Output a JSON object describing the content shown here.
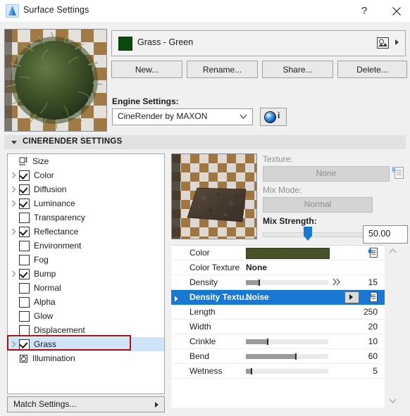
{
  "window": {
    "title": "Surface Settings",
    "icon": "archicad-triangle-icon",
    "help_label": "?",
    "close_label": "close-icon"
  },
  "material": {
    "name": "Grass - Green",
    "swatch_color": "#0a4a0a",
    "picker_icon": "image-picker-icon",
    "expand_icon": "triangle-right-icon"
  },
  "actions": [
    {
      "label": "New...",
      "name": "new-button"
    },
    {
      "label": "Rename...",
      "name": "rename-button"
    },
    {
      "label": "Share...",
      "name": "share-button"
    },
    {
      "label": "Delete...",
      "name": "delete-button"
    }
  ],
  "engine": {
    "label": "Engine Settings:",
    "selected": "CineRender by MAXON",
    "info_label": "i"
  },
  "section": {
    "title": "CINERENDER SETTINGS",
    "expanded": true
  },
  "channels": [
    {
      "label": "Size",
      "checkbox": false,
      "icon": "size-icon",
      "expandable": false,
      "selected": false
    },
    {
      "label": "Color",
      "checkbox": true,
      "icon": null,
      "expandable": true,
      "selected": false
    },
    {
      "label": "Diffusion",
      "checkbox": true,
      "icon": null,
      "expandable": true,
      "selected": false
    },
    {
      "label": "Luminance",
      "checkbox": true,
      "icon": null,
      "expandable": true,
      "selected": false
    },
    {
      "label": "Transparency",
      "checkbox": false,
      "icon": null,
      "expandable": false,
      "selected": false
    },
    {
      "label": "Reflectance",
      "checkbox": true,
      "icon": null,
      "expandable": true,
      "selected": false
    },
    {
      "label": "Environment",
      "checkbox": false,
      "icon": null,
      "expandable": false,
      "selected": false
    },
    {
      "label": "Fog",
      "checkbox": false,
      "icon": null,
      "expandable": false,
      "selected": false
    },
    {
      "label": "Bump",
      "checkbox": true,
      "icon": null,
      "expandable": true,
      "selected": false
    },
    {
      "label": "Normal",
      "checkbox": false,
      "icon": null,
      "expandable": false,
      "selected": false
    },
    {
      "label": "Alpha",
      "checkbox": false,
      "icon": null,
      "expandable": false,
      "selected": false
    },
    {
      "label": "Glow",
      "checkbox": false,
      "icon": null,
      "expandable": false,
      "selected": false
    },
    {
      "label": "Displacement",
      "checkbox": false,
      "icon": null,
      "expandable": false,
      "selected": false
    },
    {
      "label": "Grass",
      "checkbox": true,
      "icon": null,
      "expandable": true,
      "selected": true
    },
    {
      "label": "Illumination",
      "checkbox": false,
      "icon": "illumination-icon",
      "expandable": false,
      "selected": false
    }
  ],
  "match_settings": {
    "label": "Match Settings...",
    "arrow_icon": "triangle-right-icon"
  },
  "texture_panel": {
    "texture_label": "Texture:",
    "texture_value": "None",
    "texture_browse_icon": "load-texture-icon",
    "mix_mode_label": "Mix Mode:",
    "mix_mode_value": "Normal",
    "mix_strength_label": "Mix Strength:",
    "mix_strength_value": "50.00",
    "mix_strength_percent": 43
  },
  "properties": [
    {
      "name": "Color",
      "type": "color",
      "value": "",
      "swatch": "#4a5429",
      "selected": false,
      "expandable": false,
      "has_load_icon": true
    },
    {
      "name": "Color Texture",
      "type": "text",
      "value": "None",
      "selected": false,
      "expandable": false,
      "has_load_icon": false
    },
    {
      "name": "Density",
      "type": "slider",
      "value": "15",
      "percent": 15,
      "selected": false,
      "expandable": false,
      "has_chevrons": true
    },
    {
      "name": "Density Textu...",
      "type": "text",
      "value": "Noise",
      "selected": true,
      "expandable": true,
      "has_dropdown": true,
      "has_load_icon": true
    },
    {
      "name": "Length",
      "type": "number",
      "value": "250",
      "selected": false,
      "expandable": false
    },
    {
      "name": "Width",
      "type": "number",
      "value": "20",
      "selected": false,
      "expandable": false
    },
    {
      "name": "Crinkle",
      "type": "slider",
      "value": "10",
      "percent": 26,
      "selected": false,
      "expandable": false
    },
    {
      "name": "Bend",
      "type": "slider",
      "value": "60",
      "percent": 60,
      "selected": false,
      "expandable": false
    },
    {
      "name": "Wetness",
      "type": "slider",
      "value": "5",
      "percent": 6,
      "selected": false,
      "expandable": false
    }
  ],
  "scrollbar": {
    "up_icon": "chevron-up-icon",
    "down_icon": "chevron-down-icon"
  }
}
